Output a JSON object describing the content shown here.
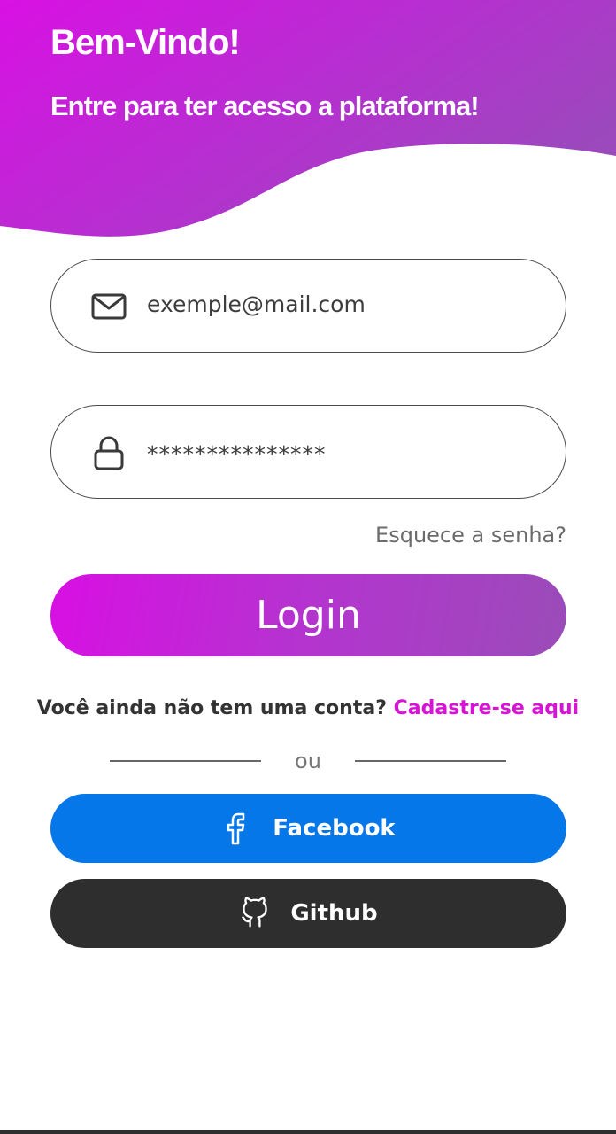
{
  "header": {
    "title": "Bem-Vindo!",
    "subtitle": "Entre para ter acesso a plataforma!"
  },
  "email_field": {
    "icon": "mail-icon",
    "value": "exemple@mail.com"
  },
  "password_field": {
    "icon": "lock-icon",
    "value": "***************"
  },
  "forgot_password": "Esquece a senha?",
  "login_button": "Login",
  "signup": {
    "prompt": "Você ainda não tem uma conta?",
    "link": "Cadastre-se aqui"
  },
  "divider_text": "ou",
  "social": {
    "facebook": {
      "label": "Facebook",
      "icon": "facebook-icon",
      "color": "#0677e8"
    },
    "github": {
      "label": "Github",
      "icon": "github-icon",
      "color": "#2e2e2e"
    }
  },
  "colors": {
    "accent_start": "#d80fe3",
    "accent_end": "#9a4cb8",
    "link": "#d812d6"
  }
}
